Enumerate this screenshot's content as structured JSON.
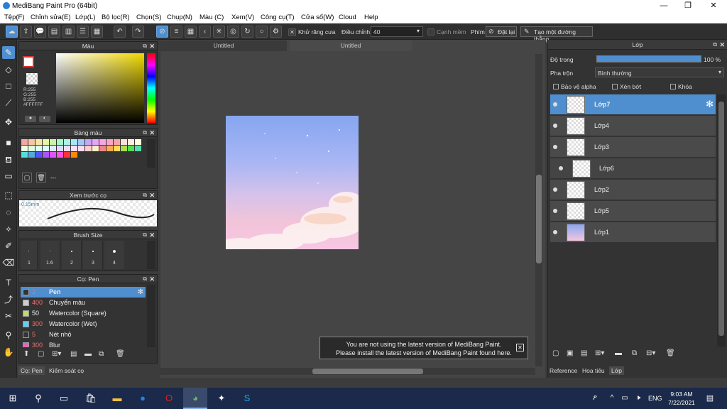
{
  "window": {
    "title": "MediBang Paint Pro (64bit)"
  },
  "menu": [
    "Tệp(F)",
    "Chỉnh sửa(E)",
    "Lớp(L)",
    "Bộ lọc(R)",
    "Chọn(S)",
    "Chụp(N)",
    "Màu (C)",
    "Xem(V)",
    "Công cụ(T)",
    "Cửa sổ(W)",
    "Cloud",
    "Help"
  ],
  "toolbar": {
    "antialias_label": "Khử răng cưa",
    "adjust_label": "Điều chỉnh",
    "adjust_value": "40",
    "snap_label": "Cạnh mềm",
    "keys_label": "Phím",
    "reset_label": "Đặt lại",
    "straight_label": "Tạo một đường thẳng"
  },
  "panels": {
    "color": {
      "title": "Màu",
      "r": "R:255",
      "g": "G:255",
      "b": "B:255",
      "hex": "#FFFFFF"
    },
    "palette": {
      "title": "Bảng màu",
      "dash": "---"
    },
    "preview": {
      "title": "Xem trước cọ",
      "size": "0.15mm"
    },
    "brushsize": {
      "title": "Brush Size",
      "sizes": [
        "1",
        "1.6",
        "2",
        "3",
        "4"
      ]
    },
    "brushes": {
      "title": "Cọ: Pen",
      "items": [
        {
          "num": "2",
          "name": "Pen",
          "color": "#333333"
        },
        {
          "num": "400",
          "name": "Chuyển màu",
          "color": "#cccccc"
        },
        {
          "num": "50",
          "name": "Watercolor (Square)",
          "color": "#b8e060"
        },
        {
          "num": "300",
          "name": "Watercolor (Wet)",
          "color": "#60d0f0"
        },
        {
          "num": "5",
          "name": "Nét nhỏ",
          "color": "#333333"
        },
        {
          "num": "300",
          "name": "Blur",
          "color": "#f060c0"
        }
      ]
    },
    "bottom_tabs": [
      "Cọ: Pen",
      "Kiểm soát cọ"
    ]
  },
  "canvas": {
    "tabs": [
      "Untitled",
      "Untitled"
    ]
  },
  "layers": {
    "title": "Lớp",
    "opacity_label": "Độ trong",
    "opacity_value": "100 %",
    "blend_label": "Pha trộn",
    "blend_value": "Bình thường",
    "alpha_label": "Bảo vệ alpha",
    "clip_label": "Xén bớt",
    "lock_label": "Khóa",
    "items": [
      "Lớp7",
      "Lớp4",
      "Lớp3",
      "Lớp6",
      "Lớp2",
      "Lớp5",
      "Lớp1"
    ],
    "tabs": [
      "Reference",
      "Hoa tiêu",
      "Lớp"
    ]
  },
  "notice": {
    "line1": "You are not using the latest version of MediBang Paint.",
    "line2": "Please install the latest version of MediBang Paint found here."
  },
  "taskbar": {
    "lang": "ENG",
    "time": "9:03 AM",
    "date": "7/22/2021"
  },
  "colors": {
    "accent": "#4f8fd0"
  }
}
